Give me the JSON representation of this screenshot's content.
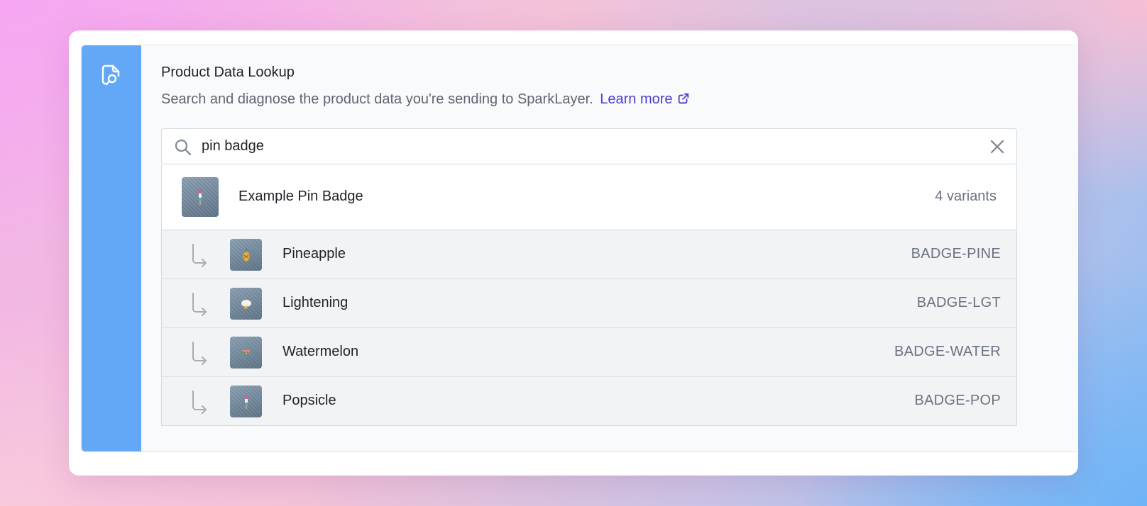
{
  "tool": {
    "title": "Product Data Lookup",
    "description": "Search and diagnose the product data you're sending to SparkLayer.",
    "learn_more": "Learn more"
  },
  "search": {
    "value": "pin badge"
  },
  "icons": {
    "rail": "document-search-icon",
    "external_link": "external-link-icon",
    "search": "search-icon",
    "clear": "close-icon",
    "branch": "branch-arrow-icon"
  },
  "colors": {
    "rail": "#63a8f7",
    "link": "#4a3fd3",
    "variant_bg": "#f1f3f5"
  },
  "product": {
    "name": "Example Pin Badge",
    "variant_count": "4 variants"
  },
  "variants": [
    {
      "name": "Pineapple",
      "sku": "BADGE-PINE"
    },
    {
      "name": "Lightening",
      "sku": "BADGE-LGT"
    },
    {
      "name": "Watermelon",
      "sku": "BADGE-WATER"
    },
    {
      "name": "Popsicle",
      "sku": "BADGE-POP"
    }
  ]
}
